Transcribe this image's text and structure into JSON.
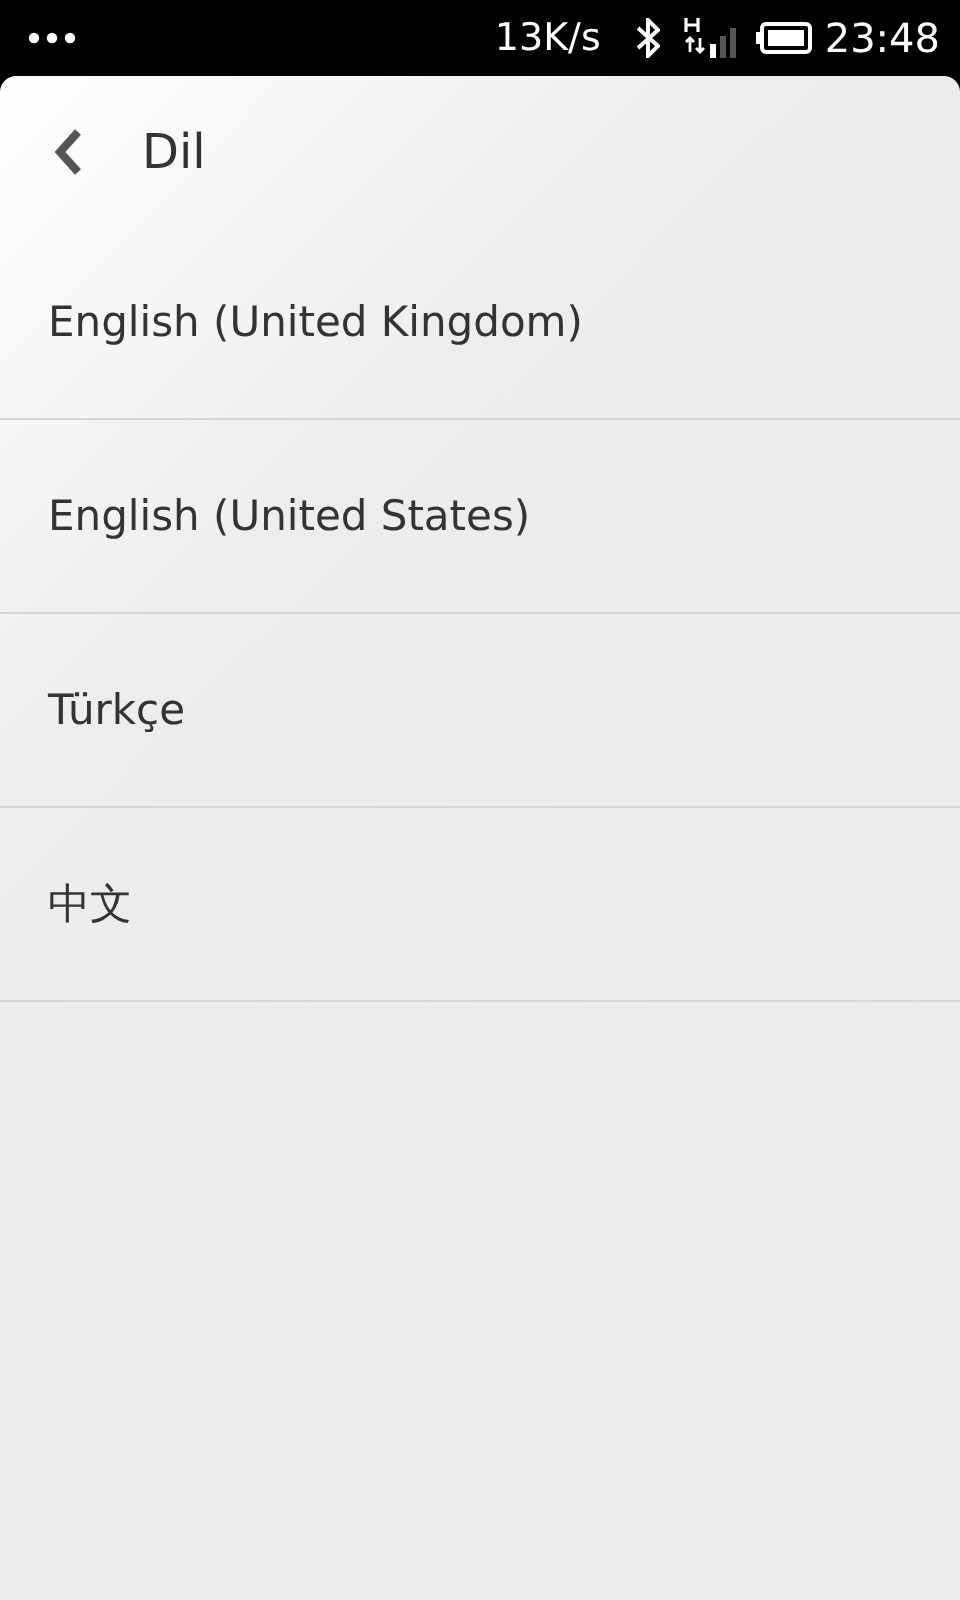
{
  "status_bar": {
    "speed": "13K/s",
    "time": "23:48"
  },
  "header": {
    "title": "Dil"
  },
  "languages": [
    {
      "label": "English (United Kingdom)"
    },
    {
      "label": "English (United States)"
    },
    {
      "label": "Türkçe"
    },
    {
      "label": "中文"
    }
  ]
}
